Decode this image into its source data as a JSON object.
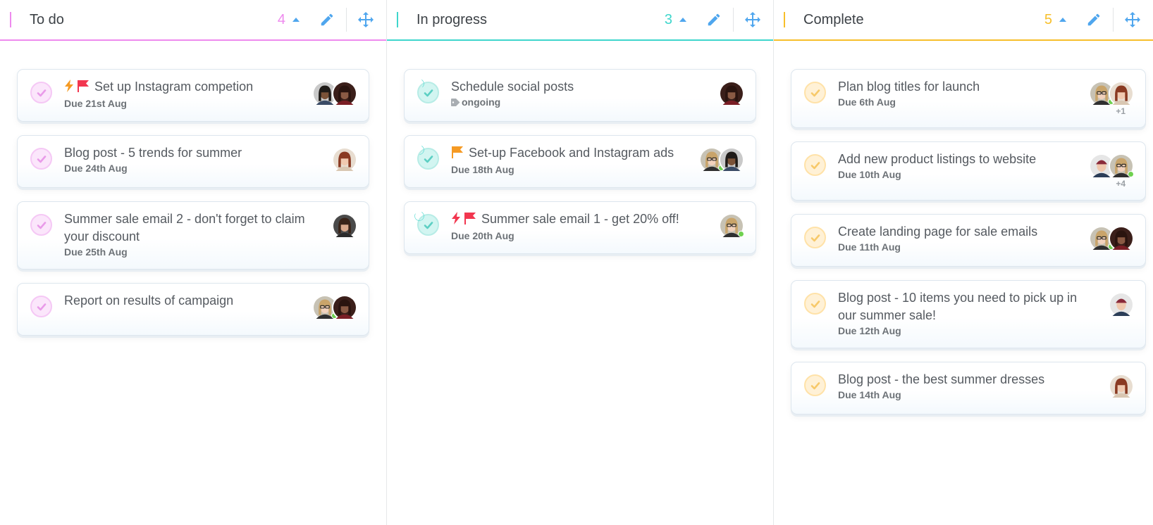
{
  "columns": [
    {
      "id": "todo",
      "title": "To do",
      "count": "4",
      "accent": "#ee8aee",
      "check_style": "todo",
      "cards": [
        {
          "title": "Set up Instagram competion",
          "markers": [
            "lightning-orange",
            "flag-red"
          ],
          "meta": "Due 21st Aug",
          "meta_type": "due",
          "avatars": [
            {
              "face": "man-beard",
              "online": false
            },
            {
              "face": "woman-curly",
              "online": false
            }
          ],
          "more": ""
        },
        {
          "title": "Blog post - 5 trends for summer",
          "markers": [],
          "meta": "Due 24th Aug",
          "meta_type": "due",
          "avatars": [
            {
              "face": "woman-red",
              "online": false
            }
          ],
          "more": ""
        },
        {
          "title": "Summer sale email 2 - don't forget to claim your discount",
          "markers": [],
          "meta": "Due 25th Aug",
          "meta_type": "due",
          "avatars": [
            {
              "face": "woman-dark",
              "online": false
            }
          ],
          "more": ""
        },
        {
          "title": "Report on results of campaign",
          "markers": [],
          "meta": "",
          "meta_type": "none",
          "avatars": [
            {
              "face": "woman-glasses",
              "online": true
            },
            {
              "face": "woman-curly",
              "online": false
            }
          ],
          "more": ""
        }
      ]
    },
    {
      "id": "in-progress",
      "title": "In progress",
      "count": "3",
      "accent": "#3fd6cc",
      "check_style": "progress",
      "cards": [
        {
          "title": "Schedule social posts",
          "markers": [],
          "meta": "ongoing",
          "meta_type": "tag",
          "avatars": [
            {
              "face": "woman-curly",
              "online": false
            }
          ],
          "more": "",
          "progress": 0.3
        },
        {
          "title": "Set-up Facebook and Instagram ads",
          "markers": [
            "flag-orange"
          ],
          "meta": "Due 18th Aug",
          "meta_type": "due",
          "avatars": [
            {
              "face": "woman-glasses",
              "online": true
            },
            {
              "face": "man-beard",
              "online": false
            }
          ],
          "more": "",
          "progress": 0.4
        },
        {
          "title": "Summer sale email 1 - get 20% off!",
          "markers": [
            "lightning-red",
            "flag-red"
          ],
          "meta": "Due 20th Aug",
          "meta_type": "due",
          "avatars": [
            {
              "face": "woman-glasses",
              "online": true
            }
          ],
          "more": "",
          "progress": 0.75
        }
      ]
    },
    {
      "id": "complete",
      "title": "Complete",
      "count": "5",
      "accent": "#f7bf2a",
      "check_style": "done",
      "cards": [
        {
          "title": "Plan blog titles for launch",
          "markers": [],
          "meta": "Due 6th Aug",
          "meta_type": "due",
          "avatars": [
            {
              "face": "woman-glasses",
              "online": true
            },
            {
              "face": "woman-red",
              "online": false
            }
          ],
          "more": "+1"
        },
        {
          "title": "Add new product listings to website",
          "markers": [],
          "meta": "Due 10th Aug",
          "meta_type": "due",
          "avatars": [
            {
              "face": "man-beanie",
              "online": false
            },
            {
              "face": "woman-glasses",
              "online": true
            }
          ],
          "more": "+4"
        },
        {
          "title": "Create landing page for sale emails",
          "markers": [],
          "meta": "Due 11th Aug",
          "meta_type": "due",
          "avatars": [
            {
              "face": "woman-glasses",
              "online": true
            },
            {
              "face": "woman-curly",
              "online": false
            }
          ],
          "more": ""
        },
        {
          "title": "Blog post - 10 items you need to pick up in our summer sale!",
          "markers": [],
          "meta": "Due 12th Aug",
          "meta_type": "due",
          "avatars": [
            {
              "face": "man-beanie",
              "online": false
            }
          ],
          "more": ""
        },
        {
          "title": "Blog post - the best summer dresses",
          "markers": [],
          "meta": "Due 14th Aug",
          "meta_type": "due",
          "avatars": [
            {
              "face": "woman-red",
              "online": false
            }
          ],
          "more": ""
        }
      ]
    }
  ],
  "icons": {
    "edit": "pencil-icon",
    "move": "move-arrows-icon",
    "collapse": "caret-up-icon",
    "check": "check-icon",
    "tag": "tag-icon"
  },
  "colors": {
    "icon_blue": "#4fa6ee",
    "online": "#6fd14f",
    "lightning_orange": "#f59a23",
    "lightning_red": "#f2364f",
    "flag_red": "#f2364f",
    "flag_orange": "#f59a23"
  }
}
